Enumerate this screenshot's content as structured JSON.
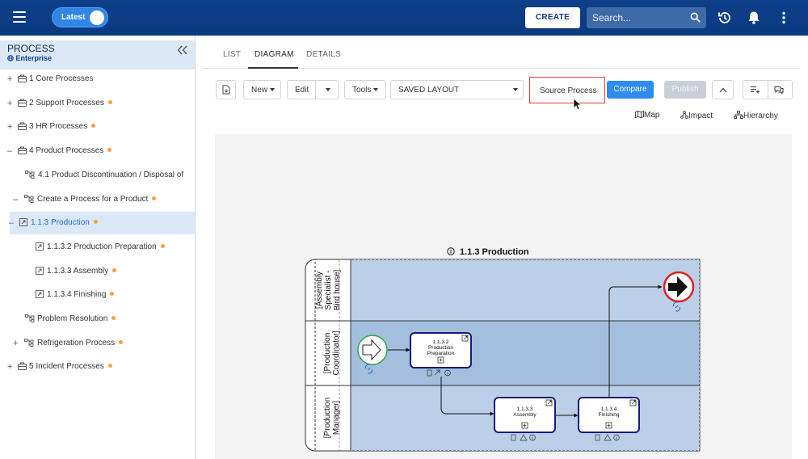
{
  "topbar": {
    "toggle_label": "Latest",
    "create_label": "CREATE",
    "search_placeholder": "Search..."
  },
  "left_panel": {
    "title": "PROCESS",
    "subtitle": "Enterprise",
    "items": [
      {
        "expander": "+",
        "icon": "briefcase-icon",
        "label": "1 Core Processes",
        "dot": false
      },
      {
        "expander": "+",
        "icon": "briefcase-icon",
        "label": "2 Support Processes",
        "dot": true
      },
      {
        "expander": "+",
        "icon": "briefcase-icon",
        "label": "3 HR Processes",
        "dot": true
      },
      {
        "expander": "–",
        "icon": "briefcase-icon",
        "label": "4 Product Processes",
        "dot": true
      },
      {
        "expander": "",
        "icon": "hierarchy-icon",
        "label": "4.1 Product Discontinuation / Disposal of",
        "dot": false
      },
      {
        "expander": "–",
        "icon": "hierarchy-icon",
        "label": "Create a Process for a Product",
        "dot": true
      },
      {
        "expander": "–",
        "icon": "external-process-icon",
        "label": "1.1.3 Production",
        "dot": true,
        "selected": true
      },
      {
        "expander": "",
        "icon": "external-process-icon",
        "label": "1.1.3.2 Production Preparation",
        "dot": true
      },
      {
        "expander": "",
        "icon": "external-process-icon",
        "label": "1.1.3.3 Assembly",
        "dot": true
      },
      {
        "expander": "",
        "icon": "external-process-icon",
        "label": "1.1.3.4 Finishing",
        "dot": true
      },
      {
        "expander": "",
        "icon": "hierarchy-icon",
        "label": "Problem Resolution",
        "dot": true
      },
      {
        "expander": "+",
        "icon": "hierarchy-icon",
        "label": "Refrigeration Process",
        "dot": true
      },
      {
        "expander": "+",
        "icon": "briefcase-icon",
        "label": "5 Incident Processes",
        "dot": true
      }
    ]
  },
  "tabs": [
    {
      "label": "LIST",
      "active": false
    },
    {
      "label": "DIAGRAM",
      "active": true
    },
    {
      "label": "DETAILS",
      "active": false
    }
  ],
  "toolbar": {
    "new_label": "New",
    "edit_label": "Edit",
    "tools_label": "Tools",
    "layout_label": "SAVED LAYOUT",
    "source_label": "Source Process",
    "compare_label": "Compare",
    "publish_label": "Publish"
  },
  "links": {
    "map": "Map",
    "impact": "Impact",
    "hierarchy": "Hierarchy"
  },
  "diagram": {
    "title": "1.1.3 Production",
    "lanes": [
      "[Assembly Specialist - Bird house]",
      "[Production Coordinator]",
      "[Production Manager]"
    ],
    "tasks": [
      {
        "id": "1.1.3.2",
        "name": "Production Preparation"
      },
      {
        "id": "1.1.3.3",
        "name": "Assembly"
      },
      {
        "id": "1.1.3.4",
        "name": "Finishing"
      }
    ]
  },
  "colors": {
    "topbar": "#0d3f8a",
    "accent": "#2d8cf0",
    "selected_bg": "#dbe8f8",
    "lane_light": "#bccfe8",
    "lane_mid": "#a3bfdd",
    "task_border": "#1a1a7a",
    "end_event": "#e02020",
    "start_event": "#2aa84a",
    "highlight": "#e53935",
    "status_dot": "#f4a13b"
  }
}
